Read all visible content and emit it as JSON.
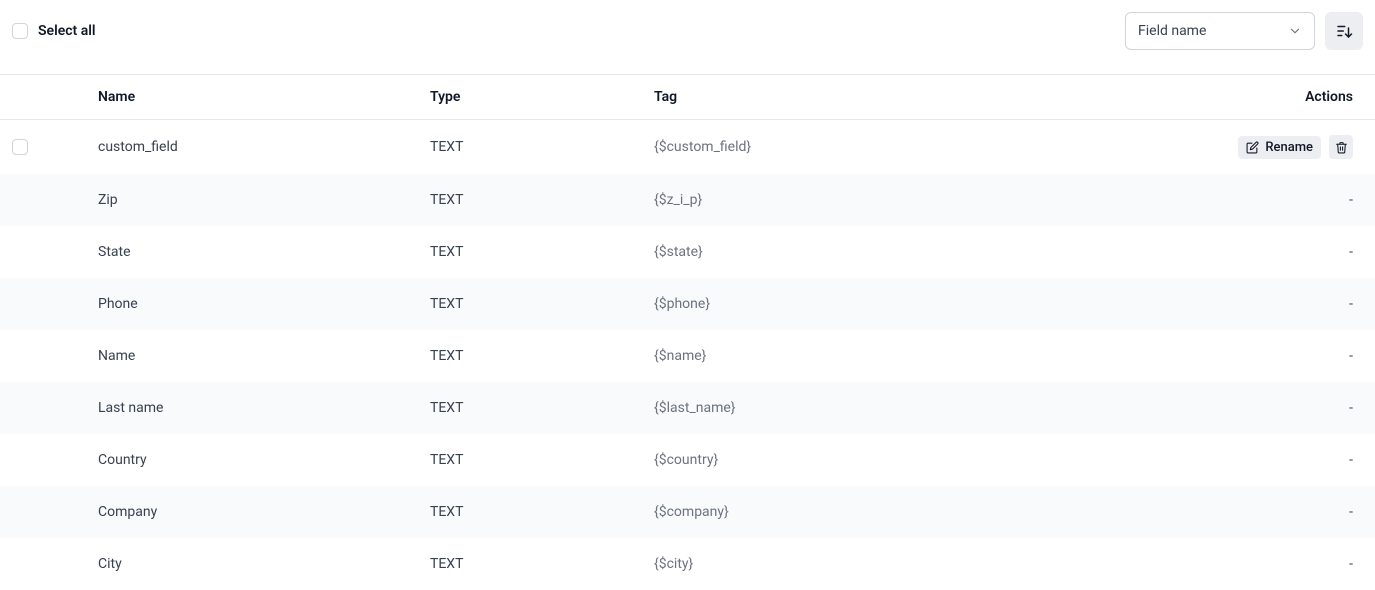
{
  "toolbar": {
    "select_all_label": "Select all",
    "sort_by_value": "Field name"
  },
  "columns": {
    "name": "Name",
    "type": "Type",
    "tag": "Tag",
    "actions": "Actions"
  },
  "actions": {
    "rename_label": "Rename",
    "dash": "-"
  },
  "rows": [
    {
      "name": "custom_field",
      "type": "TEXT",
      "tag": "{$custom_field}",
      "checkable": true,
      "has_actions": true
    },
    {
      "name": "Zip",
      "type": "TEXT",
      "tag": "{$z_i_p}",
      "checkable": false,
      "has_actions": false
    },
    {
      "name": "State",
      "type": "TEXT",
      "tag": "{$state}",
      "checkable": false,
      "has_actions": false
    },
    {
      "name": "Phone",
      "type": "TEXT",
      "tag": "{$phone}",
      "checkable": false,
      "has_actions": false
    },
    {
      "name": "Name",
      "type": "TEXT",
      "tag": "{$name}",
      "checkable": false,
      "has_actions": false
    },
    {
      "name": "Last name",
      "type": "TEXT",
      "tag": "{$last_name}",
      "checkable": false,
      "has_actions": false
    },
    {
      "name": "Country",
      "type": "TEXT",
      "tag": "{$country}",
      "checkable": false,
      "has_actions": false
    },
    {
      "name": "Company",
      "type": "TEXT",
      "tag": "{$company}",
      "checkable": false,
      "has_actions": false
    },
    {
      "name": "City",
      "type": "TEXT",
      "tag": "{$city}",
      "checkable": false,
      "has_actions": false
    }
  ]
}
